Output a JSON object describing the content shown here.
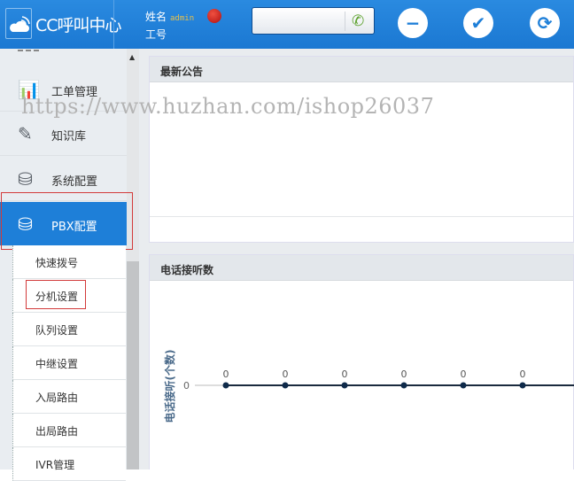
{
  "header": {
    "logo_text": "CC呼叫中心",
    "name_label": "姓名",
    "username": "admin",
    "job_label": "工号",
    "phone_value": ""
  },
  "sidebar": {
    "items": [
      {
        "label": "工单管理",
        "icon": "bar-chart-icon"
      },
      {
        "label": "知识库",
        "icon": "edit-icon"
      },
      {
        "label": "系统配置",
        "icon": "database-gear-icon"
      },
      {
        "label": "PBX配置",
        "icon": "database-gear-icon",
        "active": true
      }
    ],
    "sub_items": [
      "快速拨号",
      "分机设置",
      "队列设置",
      "中继设置",
      "入局路由",
      "出局路由",
      "IVR管理"
    ]
  },
  "panels": {
    "notice_title": "最新公告",
    "calls_title": "电话接听数"
  },
  "watermark": "https://www.huzhan.com/ishop26037",
  "chart_data": {
    "type": "line",
    "title": "",
    "ylabel": "电话接听(个数)",
    "y_ticks": [
      "0"
    ],
    "values": [
      0,
      0,
      0,
      0,
      0,
      0
    ],
    "data_labels": [
      "0",
      "0",
      "0",
      "0",
      "0",
      "0"
    ],
    "line_color": "#1a2a3e"
  },
  "colors": {
    "header": "#1e7fd8",
    "active": "#1e7fd8",
    "highlight": "#d23a3a"
  }
}
